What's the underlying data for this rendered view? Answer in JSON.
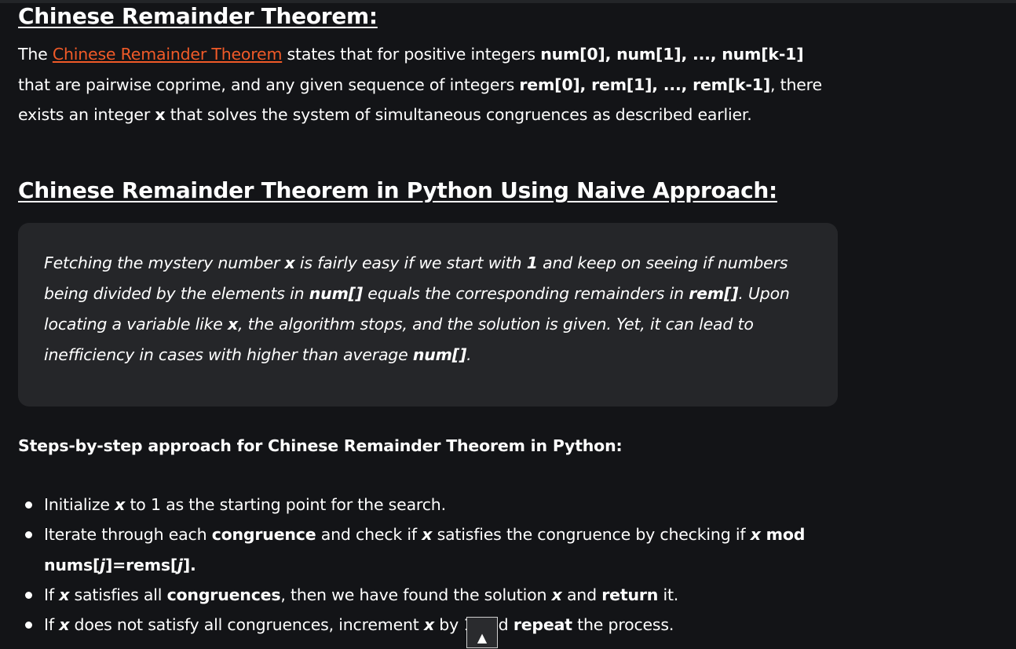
{
  "heading1": "Chinese Remainder Theorem:",
  "intro": {
    "t1": "The ",
    "link": "Chinese Remainder Theorem",
    "t2": " states that for positive integers ",
    "b1": "num[0], num[1], ..., num[k-1]",
    "t3": " that are pairwise coprime, and any given sequence of integers ",
    "b2": "rem[0], rem[1], ..., rem[k-1]",
    "t4": ", there exists an integer ",
    "b3": "x",
    "t5": " that solves the system of simultaneous congruences as described earlier."
  },
  "heading2": "Chinese Remainder Theorem in Python Using Naive Approach:",
  "note": {
    "t1": "Fetching the mystery number ",
    "b1": "x",
    "t2": " is fairly easy if we start with ",
    "b2": "1",
    "t3": " and keep on seeing if numbers being divided by the elements in ",
    "b3": "num[]",
    "t4": " equals the corresponding remainders in ",
    "b4": "rem[]",
    "t5": ". Upon locating a variable like ",
    "b5": "x",
    "t6": ", the algorithm stops, and the solution is given. Yet, it can lead to inefficiency in cases with higher than average ",
    "b6": "num[]",
    "t7": "."
  },
  "steps_title": "Steps-by-step approach for Chinese Remainder Theorem in Python:",
  "steps": [
    {
      "t1": "Initialize ",
      "x": "x",
      "t2": " to 1 as the starting point for the search."
    },
    {
      "t1": "Iterate through each ",
      "b1": "congruence",
      "t2": " and check if ",
      "x": "x",
      "t3": " satisfies the congruence by checking if ",
      "x2": "x",
      "b2a": " mod nums[",
      "j1": "j",
      "b2b": "]=rems[",
      "j2": "j",
      "b2c": "]."
    },
    {
      "t1": "If ",
      "x": "x",
      "t2": " satisfies all ",
      "b1": "congruences",
      "t3": ", then we have found the solution ",
      "x2": "x",
      "t4": " and ",
      "b2": "return",
      "t5": " it."
    },
    {
      "t1": "If ",
      "x": "x",
      "t2": " does not satisfy all congruences, increment ",
      "x2": "x",
      "t3": " by 1 and ",
      "b1": "repeat",
      "t4": " the process."
    }
  ],
  "scroll_top_icon": "▲"
}
